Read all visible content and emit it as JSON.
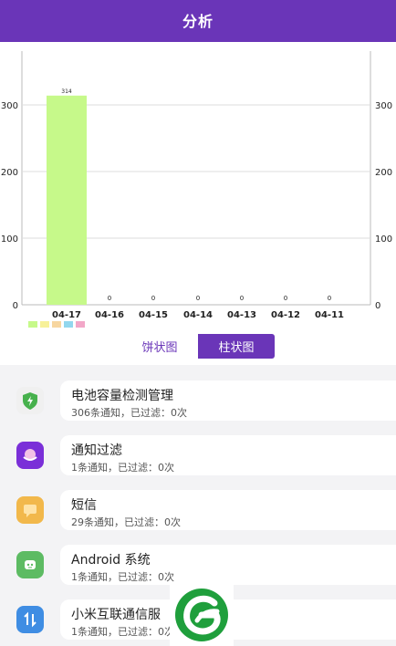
{
  "header": {
    "title": "分析"
  },
  "chart_data": {
    "type": "bar",
    "categories": [
      "04-17",
      "04-16",
      "04-15",
      "04-14",
      "04-13",
      "04-12",
      "04-11"
    ],
    "values": [
      314,
      0,
      0,
      0,
      0,
      0,
      0
    ],
    "data_labels": [
      "314",
      "0",
      "0",
      "0",
      "0",
      "0",
      "0"
    ],
    "ylim": [
      0,
      300
    ],
    "yticks": [
      0,
      100,
      200,
      300
    ],
    "grid": true,
    "bar_color": "#c6f98a",
    "legend_colors": [
      "#c6f98a",
      "#f7f199",
      "#f7d6a0",
      "#92d7ee",
      "#f2a7c8"
    ]
  },
  "toggle": {
    "pie_label": "饼状图",
    "bar_label": "柱状图",
    "selected": "bar"
  },
  "apps": [
    {
      "name": "电池容量检测管理",
      "stats": "306条通知，已过滤：0次",
      "icon": "battery-shield-icon",
      "color": "#ffffff"
    },
    {
      "name": "通知过滤",
      "stats": "1条通知，已过滤：0次",
      "icon": "notification-filter-icon",
      "color": "#7a2fd8"
    },
    {
      "name": "短信",
      "stats": "29条通知，已过滤：0次",
      "icon": "message-icon",
      "color": "#f2b84b"
    },
    {
      "name": "Android 系统",
      "stats": "1条通知，已过滤：0次",
      "icon": "android-icon",
      "color": "#5dbb63"
    },
    {
      "name": "小米互联通信服",
      "stats": "1条通知，已过滤：0次",
      "icon": "transfer-icon",
      "color": "#3f8de3"
    }
  ],
  "theme": {
    "accent": "#6a35b8"
  }
}
